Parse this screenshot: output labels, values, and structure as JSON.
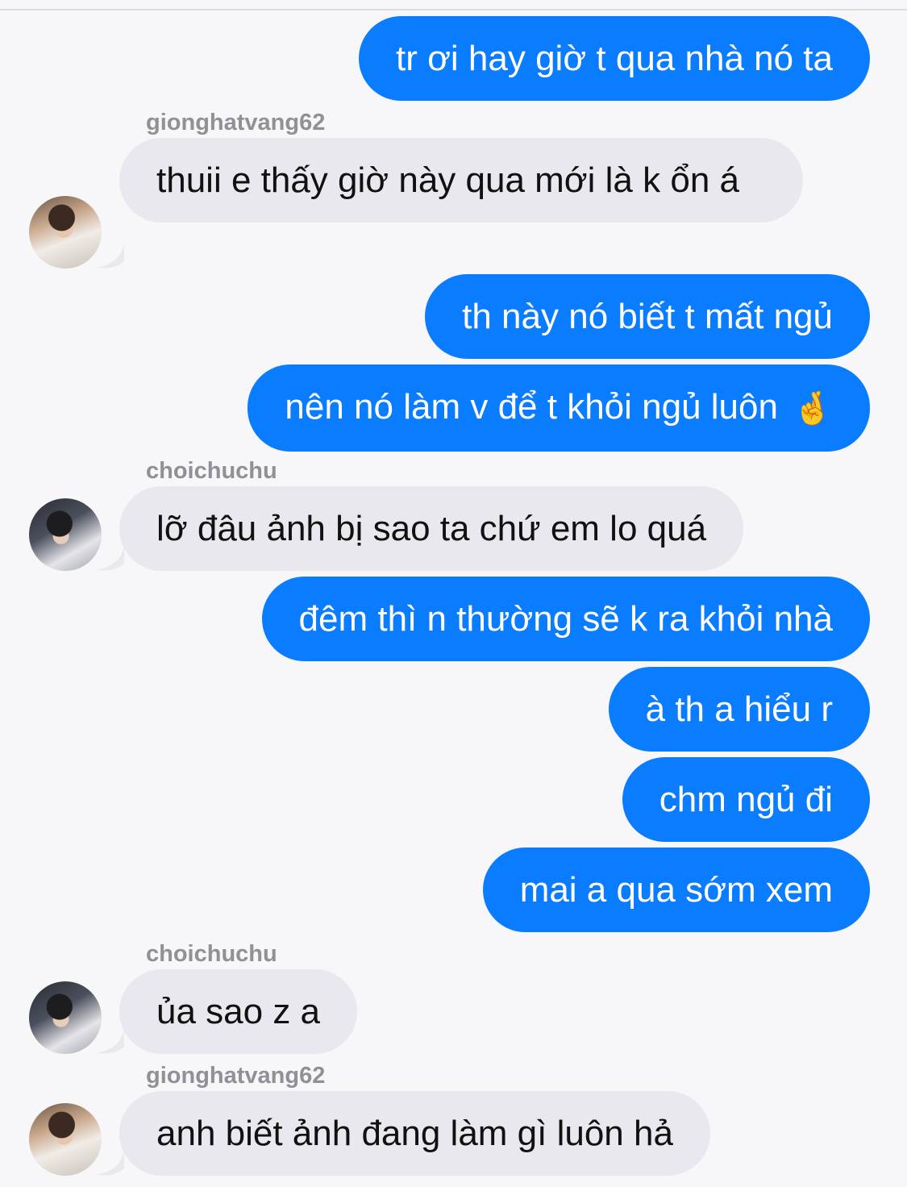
{
  "messages": [
    {
      "direction": "out",
      "text": "tr ơi hay giờ t qua nhà nó ta"
    },
    {
      "direction": "in",
      "sender": "giongh atvang62",
      "text": ""
    },
    {
      "direction": "in",
      "sender": "gionghatvang62",
      "text": "thuii e thấy giờ này qua mới là k ổn á"
    },
    {
      "direction": "out",
      "text": "th này nó biết t mất ngủ"
    },
    {
      "direction": "out",
      "text": "nên nó làm v để t khỏi ngủ luôn",
      "emoji": "🤞"
    },
    {
      "direction": "in",
      "sender": "choichuchu",
      "text": "lỡ đâu ảnh bị sao ta chứ em lo quá"
    },
    {
      "direction": "out",
      "text": "đêm thì n thường sẽ k ra khỏi nhà"
    },
    {
      "direction": "out",
      "text": "à th a hiểu r"
    },
    {
      "direction": "out",
      "text": "chm ngủ đi"
    },
    {
      "direction": "out",
      "text": "mai a qua sớm xem"
    },
    {
      "direction": "in",
      "sender": "choichuchu",
      "text": "ủa sao z a"
    },
    {
      "direction": "in",
      "sender": "gionghatvang62",
      "text": "anh biết ảnh đang làm gì luôn hả"
    }
  ],
  "colors": {
    "outgoing_bubble": "#0a7cff",
    "incoming_bubble": "#e9e8ee",
    "background": "#f7f6f9",
    "sender_name": "#909096"
  }
}
